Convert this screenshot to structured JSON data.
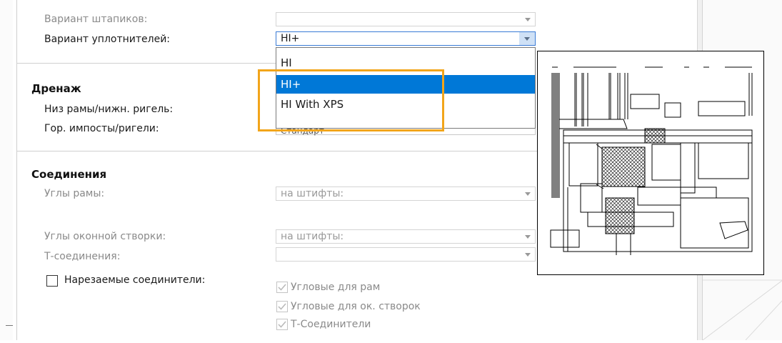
{
  "form": {
    "top_partial_label": "Вариант штапиков:",
    "seal_label": "Вариант уплотнителей:",
    "seal_value": "HI+",
    "drainage": {
      "title": "Дренаж",
      "bottom_label": "Низ рамы/нижн. ригель:",
      "horiz_label": "Гор. импосты/ригели:",
      "horiz_value_partial": "Стандарт"
    },
    "connections": {
      "title": "Соединения",
      "frame_corners_label": "Углы рамы:",
      "frame_corners_value": "на штифты:",
      "sash_corners_label": "Углы оконной створки:",
      "sash_corners_value": "на штифты:",
      "t_joints_label": "Т-соединения:",
      "cut_connectors_label": "Нарезаемые соединители:",
      "option_frames": "Угловые для рам",
      "option_sashes": "Угловые для ок. створок",
      "option_t": "Т-Соединители"
    }
  },
  "dropdown": {
    "options": [
      "HI",
      "HI+",
      "HI With XPS"
    ],
    "selected_index": 1
  },
  "colors": {
    "highlight_box": "#f2a51a",
    "selection": "#0078d7",
    "focus_border": "#3a7bd5"
  },
  "icons": [
    "chevron-down-icon",
    "checkmark-icon",
    "profile-cross-section-drawing"
  ]
}
